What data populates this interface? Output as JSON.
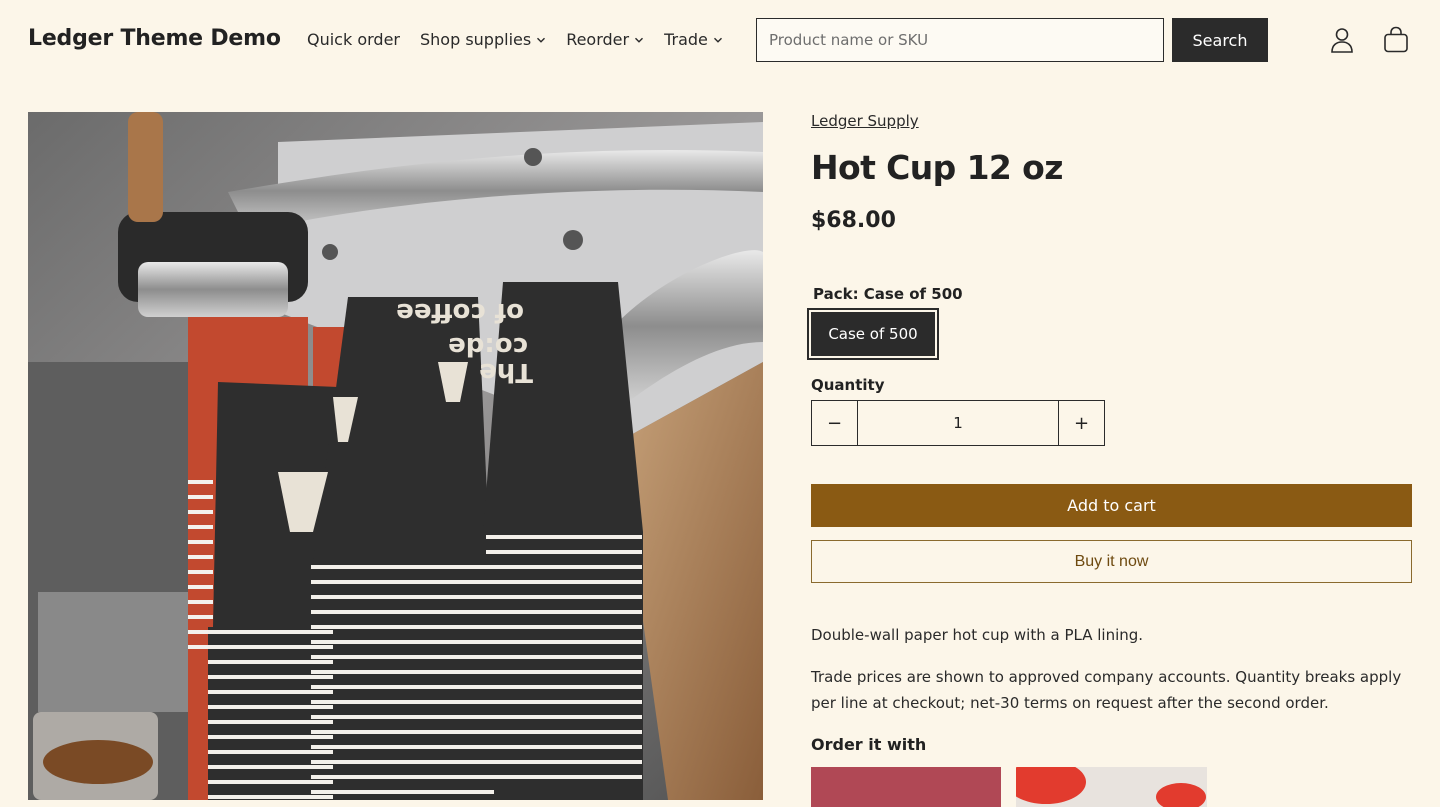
{
  "header": {
    "logo": "Ledger Theme Demo",
    "nav": [
      {
        "label": "Quick order",
        "dropdown": false
      },
      {
        "label": "Shop supplies",
        "dropdown": true
      },
      {
        "label": "Reorder",
        "dropdown": true
      },
      {
        "label": "Trade",
        "dropdown": true
      }
    ],
    "search": {
      "placeholder": "Product name or SKU",
      "value": "",
      "button_label": "Search"
    },
    "icons": [
      "account-icon",
      "cart-icon"
    ]
  },
  "product": {
    "image_alt": "Stacked black and red paper hot cups branded 'The co:de of coffee' beside an espresso machine",
    "cup_print_lines": [
      "The",
      "co:de",
      "of coffee"
    ],
    "vendor": "Ledger Supply",
    "title": "Hot Cup 12 oz",
    "price": "$68.00",
    "pack": {
      "label": "Pack: Case of 500",
      "options": [
        "Case of 500"
      ],
      "selected": "Case of 500"
    },
    "quantity": {
      "label": "Quantity",
      "value": "1",
      "minus": "−",
      "plus": "+"
    },
    "add_to_cart": "Add to cart",
    "buy_now": "Buy it now",
    "description": [
      "Double-wall paper hot cup with a PLA lining.",
      "Trade prices are shown to approved company accounts. Quantity breaks apply per line at checkout; net-30 terms on request after the second order."
    ],
    "order_with": {
      "heading": "Order it with"
    }
  },
  "colors": {
    "background": "#fcf6e9",
    "primary_dark": "#2b2b2b",
    "accent": "#8a5a13",
    "text": "#222222"
  }
}
